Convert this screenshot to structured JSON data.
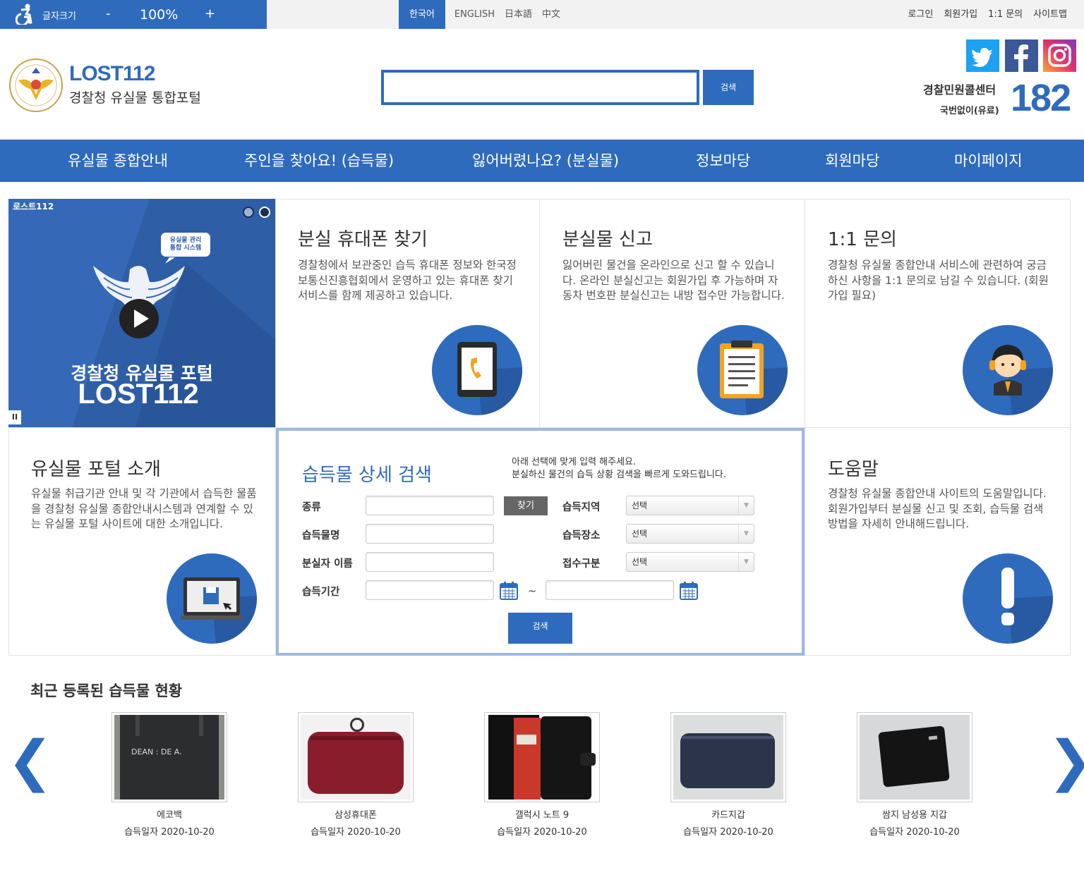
{
  "topbar": {
    "font_size_label": "글자크기",
    "minus": "-",
    "zoom": "100%",
    "plus": "+",
    "languages": [
      "한국어",
      "ENGLISH",
      "日本語",
      "中文"
    ],
    "links": [
      "로그인",
      "회원가입",
      "1:1 문의",
      "사이트맵"
    ]
  },
  "header": {
    "logo_title": "LOST112",
    "logo_subtitle": "경찰청 유실물 통합포털",
    "search_value": "",
    "search_button": "검색",
    "call_center_label": "경찰민원콜센터",
    "call_center_note": "국번없이(유료)",
    "call_center_number": "182"
  },
  "nav": [
    "유실물 종합안내",
    "주인을 찾아요! (습득물)",
    "잃어버렸나요? (분실물)",
    "정보마당",
    "회원마당",
    "마이페이지"
  ],
  "video": {
    "tag": "로스트112",
    "bubble_line1": "유실물 관리",
    "bubble_line2": "통합 시스템",
    "caption_line1": "경찰청 유실물 포털",
    "caption_line2": "LOST112"
  },
  "cards": {
    "phone": {
      "title": "분실 휴대폰 찾기",
      "text": "경찰청에서 보관중인 습득 휴대폰 정보와 한국정보통신진흥협회에서 운영하고 있는 휴대폰 찾기 서비스를 함께 제공하고 있습니다."
    },
    "report": {
      "title": "분실물 신고",
      "text": "잃어버린 물건을 온라인으로 신고 할 수 있습니다. 온라인 분실신고는 회원가입 후 가능하며 자동차 번호판 분실신고는 내방 접수만 가능합니다."
    },
    "inquiry": {
      "title": "1:1 문의",
      "text": "경찰청 유실물 종합안내 서비스에 관련하여 궁금하신 사항을 1:1 문의로 남길 수 있습니다. (회원가입 필요)"
    },
    "intro": {
      "title": "유실물 포털 소개",
      "text": "유실물 취급기관 안내 및 각 기관에서 습득한 물품을 경찰청 유실물 종합안내시스템과 연계할 수 있는 유실물 포털 사이트에 대한 소개입니다."
    },
    "help": {
      "title": "도움말",
      "text": "경찰청 유실물 종합안내 사이트의 도움말입니다. 회원가입부터 분실물 신고 및 조회, 습득물 검색 방법을 자세히 안내해드립니다."
    }
  },
  "search_form": {
    "title": "습득물 상세 검색",
    "desc_line1": "아래 선택에 맞게 입력 해주세요.",
    "desc_line2": "분실하신 물건의 습득 상황 검색을 빠르게 도와드립니다.",
    "labels": {
      "type": "종류",
      "item_name": "습득물명",
      "owner_name": "분실자 이름",
      "period": "습득기간",
      "region": "습득지역",
      "place": "습득장소",
      "category": "접수구분"
    },
    "find_button": "찾기",
    "select_default": "선택",
    "tilde": "~",
    "search_button": "검색"
  },
  "recent": {
    "title": "최근 등록된 습득물 현황",
    "prev": "❮",
    "next": "❯",
    "date_label": "습득일자",
    "items": [
      {
        "name": "에코백",
        "date": "2020-10-20"
      },
      {
        "name": "삼성휴대폰",
        "date": "2020-10-20"
      },
      {
        "name": "갤럭시 노트 9",
        "date": "2020-10-20"
      },
      {
        "name": "카드지갑",
        "date": "2020-10-20"
      },
      {
        "name": "쌈지 남성용 지갑",
        "date": "2020-10-20"
      }
    ],
    "ecobag_text": "DEAN : DE A."
  },
  "colors": {
    "brand": "#2f6bbd",
    "search_border": "#9cb9e0",
    "topbar": "#f2f2f2"
  },
  "icons": [
    "accessibility-icon",
    "twitter-icon",
    "facebook-icon",
    "instagram-icon",
    "police-emblem-icon",
    "play-icon",
    "pause-icon",
    "tablet-phone-icon",
    "clipboard-icon",
    "operator-icon",
    "monitor-save-icon",
    "exclamation-icon",
    "calendar-icon"
  ]
}
